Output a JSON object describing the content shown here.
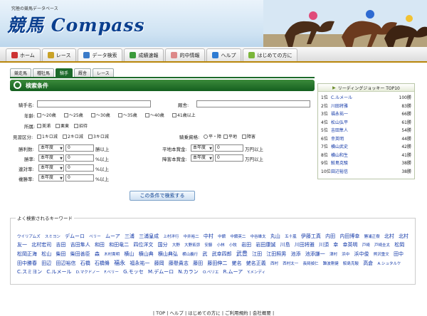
{
  "header": {
    "tagline": "究極の競馬データベース",
    "logo": "競馬 Compass"
  },
  "nav": [
    {
      "label": "ホーム",
      "icon": "home-icon",
      "color": "#c33"
    },
    {
      "label": "レース",
      "icon": "flag-icon",
      "color": "#c9a227"
    },
    {
      "label": "データ検索",
      "icon": "search-icon",
      "color": "#3a7ac8"
    },
    {
      "label": "成績速報",
      "icon": "chart-icon",
      "color": "#3a9a3a"
    },
    {
      "label": "的中情報",
      "icon": "target-icon",
      "color": "#d88"
    },
    {
      "label": "ヘルプ",
      "icon": "help-icon",
      "color": "#2e7bd2"
    },
    {
      "label": "はじめての方に",
      "icon": "book-icon",
      "color": "#7bb63a"
    }
  ],
  "subtabs": [
    "競走馬",
    "種牡馬",
    "騎手",
    "厩舎",
    "レース"
  ],
  "panel": {
    "title": "検索条件",
    "jockey_name_label": "騎手名:",
    "stable_label": "厩舎:",
    "age_label": "年齢:",
    "ages": [
      "～20歳",
      "～25歳",
      "～30歳",
      "～35歳",
      "～40歳",
      "41歳以上"
    ],
    "affil_label": "所属:",
    "affils": [
      "美浦",
      "栗東",
      "招待"
    ],
    "license_label": "見習区分:",
    "licenses": [
      "1キロ減",
      "2キロ減",
      "3キロ減"
    ],
    "qual_label": "騎乗資格:",
    "quals": [
      "平・障",
      "平地",
      "障害"
    ],
    "win_count_label": "勝利数:",
    "win_rate_label": "勝率:",
    "place_rate_label": "連対率:",
    "show_rate_label": "複勝率:",
    "year_select": "本年度",
    "win_count_value": "0",
    "win_rate_value": "0",
    "place_rate_value": "0",
    "show_rate_value": "0",
    "win_count_unit": "勝以上",
    "rate_unit": "%以上",
    "flat_prize_label": "平地本賞金:",
    "jump_prize_label": "障害本賞金:",
    "flat_prize_value": "0",
    "jump_prize_value": "0",
    "prize_unit": "万円以上",
    "search_button": "この条件で検索する"
  },
  "ranking": {
    "title": "リーディングジョッキー TOP10",
    "rows": [
      {
        "rank": "1位",
        "name": "C.ルメール",
        "wins": "100勝"
      },
      {
        "rank": "2位",
        "name": "川田将雅",
        "wins": "83勝"
      },
      {
        "rank": "3位",
        "name": "福永祐一",
        "wins": "66勝"
      },
      {
        "rank": "4位",
        "name": "松山弘平",
        "wins": "61勝"
      },
      {
        "rank": "5位",
        "name": "吉田隼人",
        "wins": "54勝"
      },
      {
        "rank": "6位",
        "name": "幸英明",
        "wins": "44勝"
      },
      {
        "rank": "7位",
        "name": "横山武史",
        "wins": "42勝"
      },
      {
        "rank": "8位",
        "name": "横山和生",
        "wins": "41勝"
      },
      {
        "rank": "9位",
        "name": "鮫島克駿",
        "wins": "38勝"
      },
      {
        "rank": "10位",
        "name": "田辺裕信",
        "wins": "38勝"
      }
    ]
  },
  "keywords": {
    "title": "よく検索されるキーワード",
    "items": [
      {
        "t": "ウイリアムズ",
        "s": "s"
      },
      {
        "t": "スミヨン",
        "s": "s"
      },
      {
        "t": "デムーロ",
        "s": "m"
      },
      {
        "t": "ベリー",
        "s": "s"
      },
      {
        "t": "ムーア",
        "s": "m"
      },
      {
        "t": "三浦",
        "s": "m"
      },
      {
        "t": "三浦皇成",
        "s": "m"
      },
      {
        "t": "上村洋行",
        "s": "s"
      },
      {
        "t": "中井裕二",
        "s": "s"
      },
      {
        "t": "中村",
        "s": "m"
      },
      {
        "t": "中舘",
        "s": "s"
      },
      {
        "t": "中舘英二",
        "s": "s"
      },
      {
        "t": "中谷雄太",
        "s": "s"
      },
      {
        "t": "丸山",
        "s": "m"
      },
      {
        "t": "五十嵐",
        "s": "s"
      },
      {
        "t": "伊藤工真",
        "s": "m"
      },
      {
        "t": "内田",
        "s": "m"
      },
      {
        "t": "内田博幸",
        "s": "m"
      },
      {
        "t": "勝浦正樹",
        "s": "s"
      },
      {
        "t": "北村",
        "s": "m"
      },
      {
        "t": "北村友一",
        "s": "m"
      },
      {
        "t": "北村宏司",
        "s": "m"
      },
      {
        "t": "吉田",
        "s": "m"
      },
      {
        "t": "吉田隼人",
        "s": "m"
      },
      {
        "t": "和田",
        "s": "m"
      },
      {
        "t": "和田竜二",
        "s": "m"
      },
      {
        "t": "四位洋文",
        "s": "m"
      },
      {
        "t": "国分",
        "s": "m"
      },
      {
        "t": "大野",
        "s": "s"
      },
      {
        "t": "大野拓弥",
        "s": "s"
      },
      {
        "t": "安藤",
        "s": "s"
      },
      {
        "t": "小林",
        "s": "s"
      },
      {
        "t": "小牧",
        "s": "s"
      },
      {
        "t": "岩田",
        "s": "m"
      },
      {
        "t": "岩田康誠",
        "s": "m"
      },
      {
        "t": "川島",
        "s": "m"
      },
      {
        "t": "川田将雅",
        "s": "m"
      },
      {
        "t": "川須",
        "s": "m"
      },
      {
        "t": "幸",
        "s": "m"
      },
      {
        "t": "幸英明",
        "s": "m"
      },
      {
        "t": "戸崎",
        "s": "s"
      },
      {
        "t": "戸崎圭太",
        "s": "s"
      },
      {
        "t": "松岡",
        "s": "m"
      },
      {
        "t": "松岡正海",
        "s": "m"
      },
      {
        "t": "松山",
        "s": "m"
      },
      {
        "t": "柴田",
        "s": "m"
      },
      {
        "t": "柴田善臣",
        "s": "m"
      },
      {
        "t": "森",
        "s": "m"
      },
      {
        "t": "木村貴明",
        "s": "s"
      },
      {
        "t": "横山",
        "s": "m"
      },
      {
        "t": "横山典",
        "s": "m"
      },
      {
        "t": "横山典弘",
        "s": "m"
      },
      {
        "t": "横山義行",
        "s": "s"
      },
      {
        "t": "武",
        "s": "m"
      },
      {
        "t": "武幸四郎",
        "s": "m"
      },
      {
        "t": "武豊",
        "s": "l"
      },
      {
        "t": "江田",
        "s": "m"
      },
      {
        "t": "江田照男",
        "s": "m"
      },
      {
        "t": "池添",
        "s": "m"
      },
      {
        "t": "池添謙一",
        "s": "m"
      },
      {
        "t": "津村",
        "s": "s"
      },
      {
        "t": "浜中",
        "s": "s"
      },
      {
        "t": "浜中俊",
        "s": "m"
      },
      {
        "t": "熊沢重文",
        "s": "s"
      },
      {
        "t": "田中",
        "s": "m"
      },
      {
        "t": "田中勝春",
        "s": "m"
      },
      {
        "t": "田辺",
        "s": "m"
      },
      {
        "t": "田辺裕信",
        "s": "m"
      },
      {
        "t": "石橋",
        "s": "m"
      },
      {
        "t": "石橋脩",
        "s": "m"
      },
      {
        "t": "福永",
        "s": "l"
      },
      {
        "t": "福永祐一",
        "s": "m"
      },
      {
        "t": "藤岡",
        "s": "m"
      },
      {
        "t": "藤懸貴志",
        "s": "m"
      },
      {
        "t": "藤田",
        "s": "m"
      },
      {
        "t": "藤田伸二",
        "s": "m"
      },
      {
        "t": "蛯名",
        "s": "m"
      },
      {
        "t": "蛯名正義",
        "s": "m"
      },
      {
        "t": "西村",
        "s": "s"
      },
      {
        "t": "西村太一",
        "s": "s"
      },
      {
        "t": "長岡禎仁",
        "s": "s"
      },
      {
        "t": "難波剛健",
        "s": "s"
      },
      {
        "t": "鮫島克駿",
        "s": "s"
      },
      {
        "t": "高倉",
        "s": "m"
      },
      {
        "t": "A.シュタルケ",
        "s": "s"
      },
      {
        "t": "C.スミヨン",
        "s": "m"
      },
      {
        "t": "C.ルメール",
        "s": "m"
      },
      {
        "t": "D.マクドノー",
        "s": "s"
      },
      {
        "t": "F.ベリー",
        "s": "s"
      },
      {
        "t": "G.モッセ",
        "s": "m"
      },
      {
        "t": "M.デムーロ",
        "s": "m"
      },
      {
        "t": "N.カラン",
        "s": "m"
      },
      {
        "t": "O.ペリエ",
        "s": "s"
      },
      {
        "t": "R.ムーア",
        "s": "m"
      },
      {
        "t": "Y.メンディ",
        "s": "s"
      }
    ]
  },
  "footer": "| TOP | ヘルプ | はじめての方に | ご利用規約 | 会社概要 |"
}
